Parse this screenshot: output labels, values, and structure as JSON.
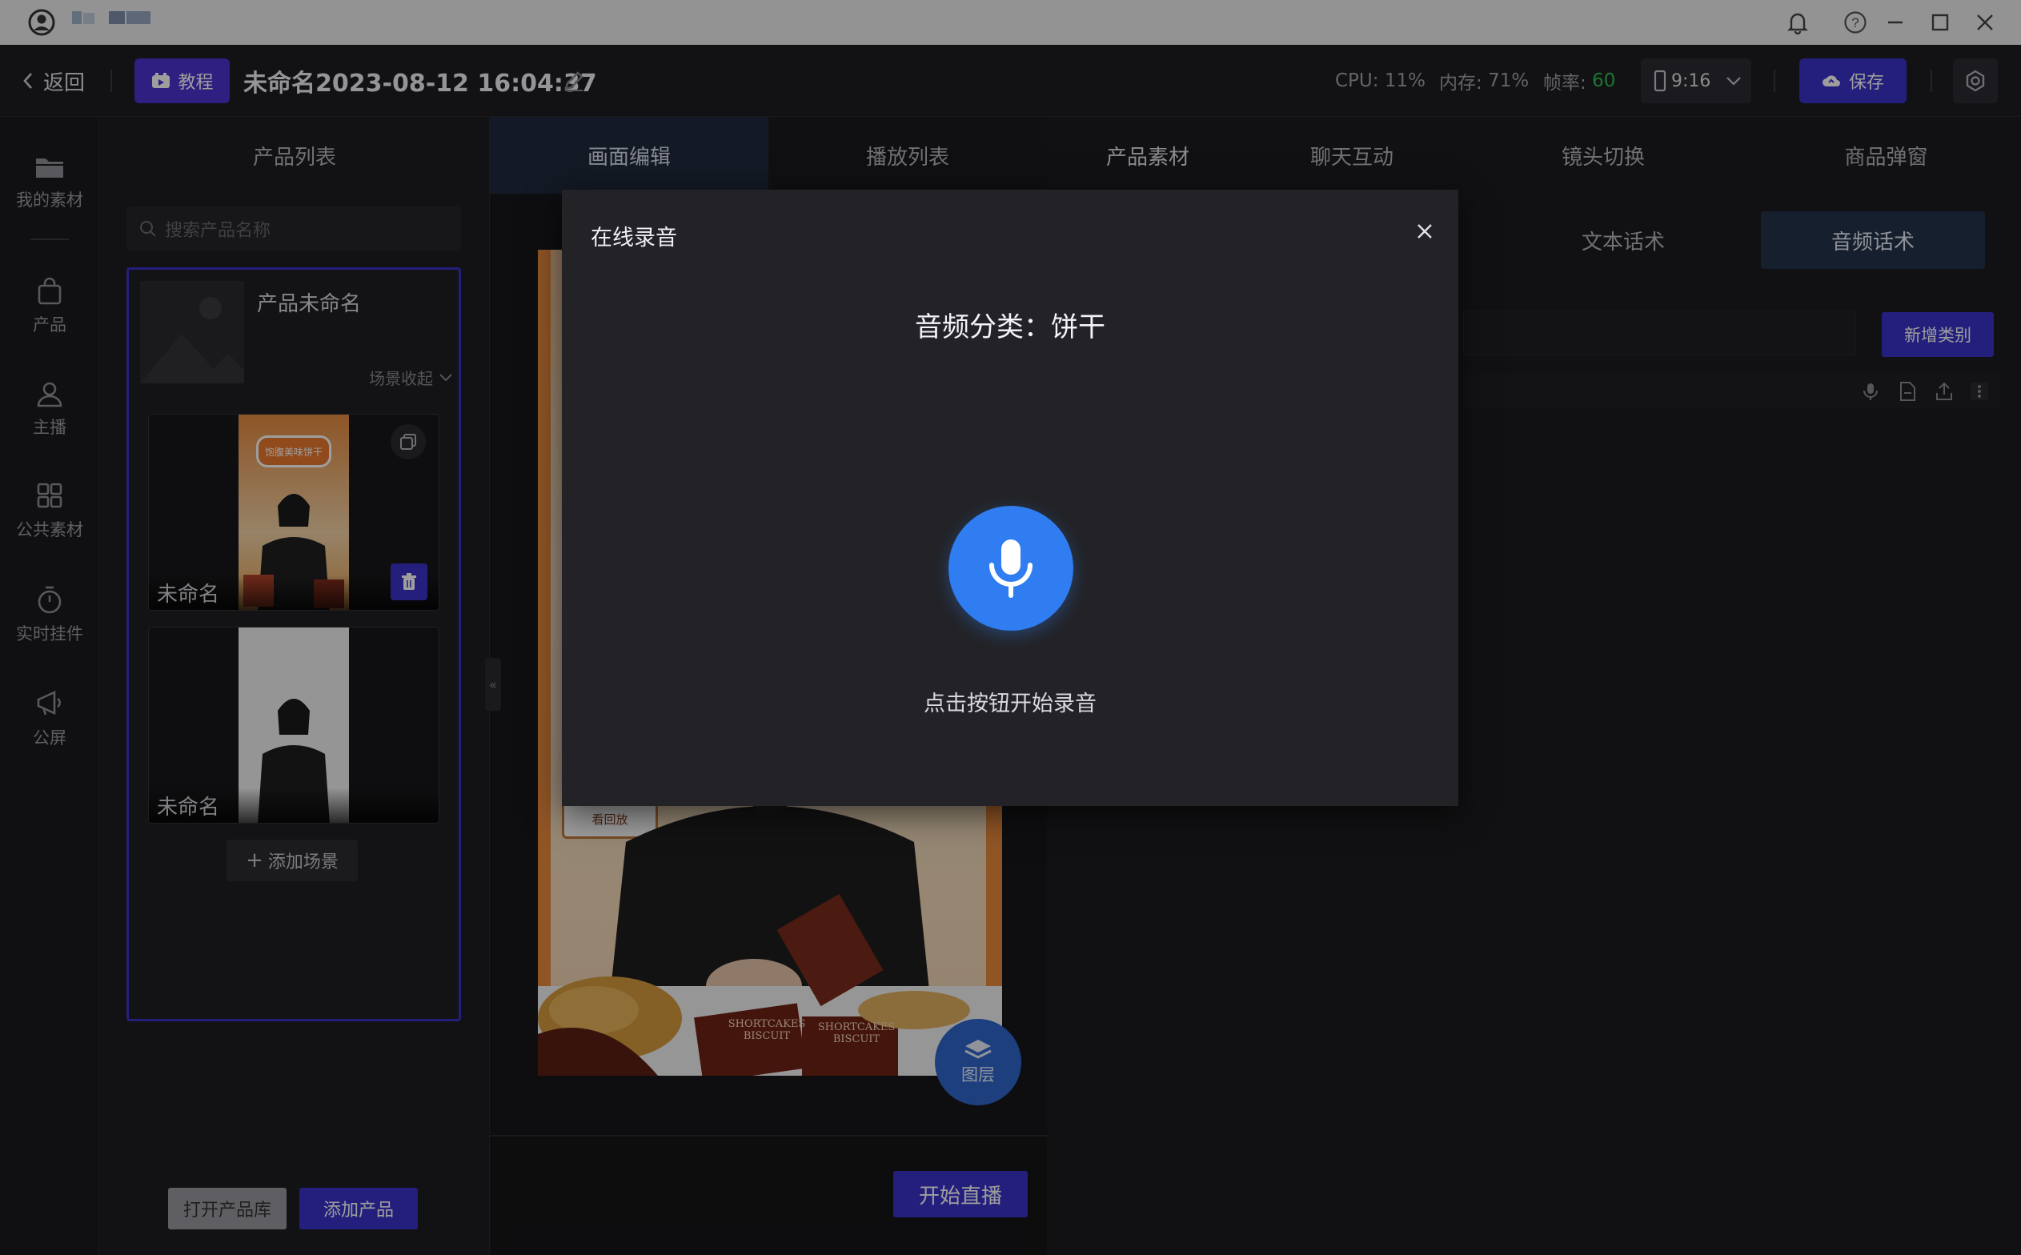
{
  "header": {
    "back_label": "返回",
    "tutorial_label": "教程",
    "project_title": "未命名2023-08-12 16:04:37",
    "cpu_label": "CPU:",
    "cpu_value": "11%",
    "mem_label": "内存:",
    "mem_value": "71%",
    "fps_label": "帧率:",
    "fps_value": "60",
    "aspect_ratio": "9:16",
    "save_label": "保存"
  },
  "rail": {
    "items": [
      {
        "label": "我的素材",
        "icon": "folder-icon"
      },
      {
        "label": "产品",
        "icon": "bag-icon"
      },
      {
        "label": "主播",
        "icon": "users-icon"
      },
      {
        "label": "公共素材",
        "icon": "grid-icon"
      },
      {
        "label": "实时挂件",
        "icon": "timer-icon"
      },
      {
        "label": "公屏",
        "icon": "megaphone-icon"
      }
    ]
  },
  "tabs": {
    "product_list": "产品列表",
    "canvas_edit": "画面编辑",
    "playlist": "播放列表",
    "product_material": "产品素材",
    "chat": "聊天互动",
    "camera_switch": "镜头切换",
    "product_popup": "商品弹窗"
  },
  "product_panel": {
    "search_placeholder": "搜索产品名称",
    "product_name": "产品未命名",
    "collapse_label": "场景收起",
    "scenes": [
      {
        "name": "未命名",
        "banner": "饱腹美味饼干"
      },
      {
        "name": "未命名"
      }
    ],
    "add_scene_label": "添加场景",
    "open_library_label": "打开产品库",
    "add_product_label": "添加产品"
  },
  "canvas": {
    "layers_label": "图层",
    "start_live_label": "开始直播",
    "biscuit_text_1": "SHORTCAKES",
    "biscuit_text_2": "BISCUIT",
    "sign_text": "看回放"
  },
  "right_panel": {
    "text_script_tab": "文本话术",
    "audio_script_tab": "音频话术",
    "new_category_label": "新增类别"
  },
  "modal": {
    "title": "在线录音",
    "category_label": "音频分类：饼干",
    "hint": "点击按钮开始录音"
  },
  "colors": {
    "accent": "#3b32c9",
    "mic_button": "#2f7df0",
    "fps_green": "#2fbf4f"
  }
}
